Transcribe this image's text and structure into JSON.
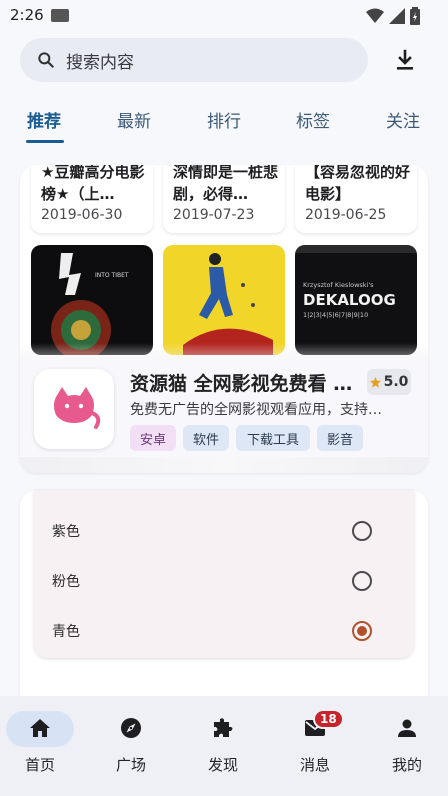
{
  "status_bar": {
    "time": "2:26"
  },
  "search": {
    "placeholder": "搜索内容"
  },
  "tabs": [
    {
      "label": "推荐",
      "active": true
    },
    {
      "label": "最新",
      "active": false
    },
    {
      "label": "排行",
      "active": false
    },
    {
      "label": "标签",
      "active": false
    },
    {
      "label": "关注",
      "active": false
    }
  ],
  "feed": {
    "articles": [
      {
        "title": "★豆瓣高分电影榜★（上…",
        "date": "2019-06-30"
      },
      {
        "title": "深情即是一桩悲剧，必得…",
        "date": "2019-07-23"
      },
      {
        "title": "【容易忽视的好电影】",
        "date": "2019-06-25"
      }
    ],
    "posters": [
      {
        "text": "INTO TIBET"
      },
      {
        "text": ""
      },
      {
        "text_top": "Krzysztof Kieslowski's",
        "text_title": "DEKALOOG",
        "text_sub": "1|2|3|4|5|6|7|8|9|10"
      }
    ]
  },
  "app": {
    "name": "资源猫 全网影视免费看 …",
    "rating": "5.0",
    "description": "免费无广告的全网影视观看应用，支持…",
    "tags": [
      "安卓",
      "软件",
      "下载工具",
      "影音"
    ]
  },
  "color_options": {
    "items": [
      {
        "label": "紫色",
        "selected": false
      },
      {
        "label": "粉色",
        "selected": false
      },
      {
        "label": "青色",
        "selected": true
      }
    ],
    "accent": "#b0532c"
  },
  "bottom_nav": {
    "items": [
      {
        "label": "首页",
        "icon": "home-icon",
        "active": true
      },
      {
        "label": "广场",
        "icon": "compass-icon",
        "active": false
      },
      {
        "label": "发现",
        "icon": "puzzle-icon",
        "active": false
      },
      {
        "label": "消息",
        "icon": "mail-icon",
        "active": false,
        "badge": "18"
      },
      {
        "label": "我的",
        "icon": "person-icon",
        "active": false
      }
    ]
  },
  "colors": {
    "primary": "#1b5d93",
    "badge": "#c4242a",
    "tag_purple": "#f2dff5",
    "tag_blue": "#dee7f5"
  }
}
